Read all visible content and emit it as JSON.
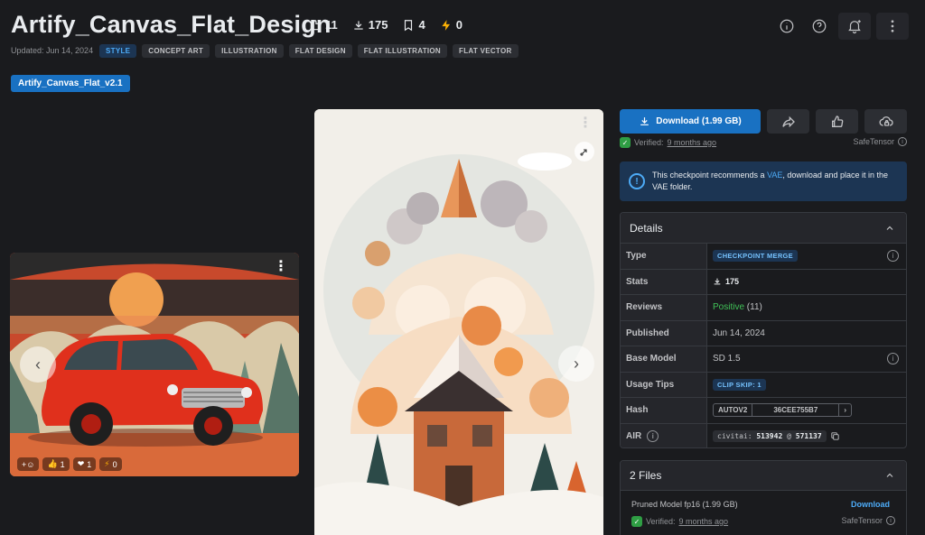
{
  "header": {
    "title": "Artify_Canvas_Flat_Design",
    "stats": {
      "likes": "11",
      "downloads": "175",
      "bookmarks": "4",
      "buzz": "0"
    },
    "updated": "Updated: Jun 14, 2024",
    "tags": [
      "STYLE",
      "CONCEPT ART",
      "ILLUSTRATION",
      "FLAT DESIGN",
      "FLAT ILLUSTRATION",
      "FLAT VECTOR"
    ],
    "icons": [
      "info-icon",
      "help-icon",
      "bell-plus-icon",
      "more-vertical-icon"
    ]
  },
  "version": {
    "label": "Artify_Canvas_Flat_v2.1"
  },
  "gallery": {
    "left_card": {
      "reactions": {
        "add": "+☺",
        "likes": "1",
        "hearts": "1",
        "buzz": "0"
      }
    },
    "nav": {
      "prev": "‹",
      "next": "›"
    },
    "dots": "⋮"
  },
  "actions": {
    "download": "Download (1.99 GB)",
    "verified_prefix": "Verified:",
    "verified_when": "9 months ago",
    "format": "SafeTensor"
  },
  "alert": {
    "text_before": "This checkpoint recommends a ",
    "link": "VAE",
    "text_after": ", download and place it in the VAE folder."
  },
  "details": {
    "heading": "Details",
    "type_label": "Type",
    "type_value": "CHECKPOINT MERGE",
    "stats_label": "Stats",
    "stats_value": "175",
    "reviews_label": "Reviews",
    "reviews_value": "Positive",
    "reviews_count": "(11)",
    "published_label": "Published",
    "published_value": "Jun 14, 2024",
    "base_model_label": "Base Model",
    "base_model_value": "SD 1.5",
    "usage_tips_label": "Usage Tips",
    "usage_tips_value": "CLIP SKIP: 1",
    "hash_label": "Hash",
    "hash_type": "AUTOV2",
    "hash_value": "36CEE755B7",
    "air_label": "AIR",
    "air_prefix": "civitai:",
    "air_model": "513942",
    "air_at": "@",
    "air_version": "571137"
  },
  "files": {
    "heading": "2 Files",
    "file_name": "Pruned Model fp16 (1.99 GB)",
    "download": "Download",
    "verified_prefix": "Verified:",
    "verified_when": "9 months ago",
    "format": "SafeTensor"
  },
  "colors": {
    "background": "#1a1b1e",
    "accent": "#1971c2",
    "link": "#4dabf7",
    "positive": "#40c057"
  }
}
